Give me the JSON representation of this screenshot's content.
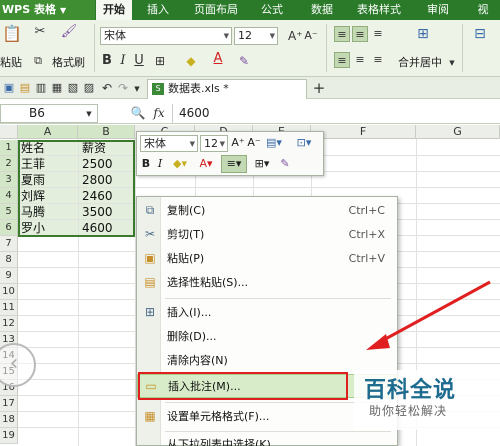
{
  "app": {
    "name": "WPS 表格"
  },
  "ribbon_tabs": [
    "开始",
    "插入",
    "页面布局",
    "公式",
    "数据",
    "表格样式",
    "审阅",
    "视"
  ],
  "ribbon": {
    "paste_label": "粘贴",
    "format_painter_label": "格式刷",
    "font_name": "宋体",
    "font_size": "12",
    "merge_center_label": "合并居中"
  },
  "document": {
    "tab_title": "数据表.xls *"
  },
  "formula_bar": {
    "name_box": "B6",
    "fx_label": "fx",
    "value": "4600"
  },
  "grid": {
    "columns": [
      "A",
      "B",
      "C",
      "D",
      "E",
      "F",
      "G"
    ],
    "row_numbers": [
      "1",
      "2",
      "3",
      "4",
      "5",
      "6",
      "7",
      "8",
      "9",
      "10",
      "11",
      "12",
      "13",
      "14",
      "15",
      "16",
      "17",
      "18",
      "19"
    ],
    "cells_a": [
      "姓名",
      "王菲",
      "夏雨",
      "刘辉",
      "马腾",
      "罗小"
    ],
    "cells_b": [
      "薪资",
      "2500",
      "2800",
      "2460",
      "3500",
      "4600"
    ]
  },
  "mini_toolbar": {
    "font_name": "宋体",
    "font_size": "12"
  },
  "context_menu": {
    "items": [
      {
        "icon": "copy-icon",
        "label": "复制(C)",
        "shortcut": "Ctrl+C"
      },
      {
        "icon": "cut-icon",
        "label": "剪切(T)",
        "shortcut": "Ctrl+X"
      },
      {
        "icon": "paste-icon",
        "label": "粘贴(P)",
        "shortcut": "Ctrl+V"
      },
      {
        "icon": "paste-special-icon",
        "label": "选择性粘贴(S)...",
        "shortcut": ""
      },
      {
        "icon": "insert-icon",
        "label": "插入(I)...",
        "shortcut": ""
      },
      {
        "icon": "",
        "label": "删除(D)...",
        "shortcut": ""
      },
      {
        "icon": "",
        "label": "清除内容(N)",
        "shortcut": ""
      },
      {
        "icon": "comment-icon",
        "label": "插入批注(M)...",
        "shortcut": "S"
      },
      {
        "icon": "format-cells-icon",
        "label": "设置单元格格式(F)...",
        "shortcut": ""
      },
      {
        "icon": "",
        "label": "从下拉列表中选择(K)...",
        "shortcut": ""
      }
    ]
  },
  "watermark": {
    "title": "百科全说",
    "subtitle": "助你轻松解决"
  },
  "colors": {
    "accent_green": "#2a7a2a",
    "selection_fill": "#e3eedc",
    "highlight_red": "#e02020"
  }
}
